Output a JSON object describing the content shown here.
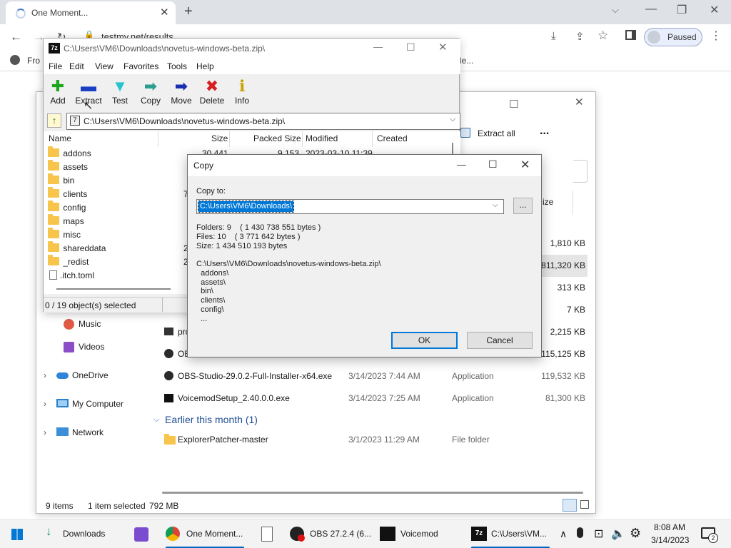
{
  "browser": {
    "tab_title": "One Moment...",
    "url": "testmy.net/results",
    "profile_label": "Paused",
    "bookmark_partial": "Fro",
    "bookmark_partial2": "le..."
  },
  "explorer": {
    "toolbar": {
      "extract_all": "Extract all",
      "more": "..."
    },
    "size_col_partial": "ize",
    "nav": [
      {
        "label": "Music"
      },
      {
        "label": "Videos"
      },
      {
        "label": "OneDrive"
      },
      {
        "label": "My Computer"
      },
      {
        "label": "Network"
      }
    ],
    "rows": [
      {
        "name": "",
        "date": "",
        "type": "",
        "size": "1,810 KB"
      },
      {
        "name": "",
        "date": "",
        "type": "",
        "size": "811,320 KB"
      },
      {
        "name": "",
        "date": "",
        "type": "",
        "size": "313 KB"
      },
      {
        "name": "",
        "date": "",
        "type": "",
        "size": "7 KB"
      },
      {
        "name": "pro",
        "date": "",
        "type": "",
        "size": "2,215 KB"
      },
      {
        "name": "OBS",
        "date": "",
        "type": "",
        "size": "115,125 KB"
      },
      {
        "name": "OBS-Studio-29.0.2-Full-Installer-x64.exe",
        "date": "3/14/2023 7:44 AM",
        "type": "Application",
        "size": "119,532 KB"
      },
      {
        "name": "VoicemodSetup_2.40.0.0.exe",
        "date": "3/14/2023 7:25 AM",
        "type": "Application",
        "size": "81,300 KB"
      }
    ],
    "group_header": "Earlier this month (1)",
    "group_row": {
      "name": "ExplorerPatcher-master",
      "date": "3/1/2023 11:29 AM",
      "type": "File folder"
    },
    "status": {
      "items": "9 items",
      "selected": "1 item selected",
      "size": "792 MB"
    }
  },
  "sevenzip": {
    "title": "C:\\Users\\VM6\\Downloads\\novetus-windows-beta.zip\\",
    "menu": [
      "File",
      "Edit",
      "View",
      "Favorites",
      "Tools",
      "Help"
    ],
    "toolbar": [
      {
        "label": "Add",
        "glyph": "✚",
        "color": "#1aa61a"
      },
      {
        "label": "Extract",
        "glyph": "▬",
        "color": "#1b3fc4"
      },
      {
        "label": "Test",
        "glyph": "▼",
        "color": "#27c4d0"
      },
      {
        "label": "Copy",
        "glyph": "➡",
        "color": "#2a9d8f"
      },
      {
        "label": "Move",
        "glyph": "➡",
        "color": "#1a2fb0"
      },
      {
        "label": "Delete",
        "glyph": "✖",
        "color": "#d62020"
      },
      {
        "label": "Info",
        "glyph": "ℹ",
        "color": "#c8a000"
      }
    ],
    "address": "C:\\Users\\VM6\\Downloads\\novetus-windows-beta.zip\\",
    "columns": [
      "Name",
      "Size",
      "Packed Size",
      "Modified",
      "Created"
    ],
    "first_row": {
      "size": "30 441",
      "packed": "9 153",
      "modified": "2023-03-10 11:39"
    },
    "partial_digits": [
      "7",
      "2",
      "2"
    ],
    "files": [
      {
        "name": "addons",
        "kind": "folder"
      },
      {
        "name": "assets",
        "kind": "folder"
      },
      {
        "name": "bin",
        "kind": "folder"
      },
      {
        "name": "clients",
        "kind": "folder"
      },
      {
        "name": "config",
        "kind": "folder"
      },
      {
        "name": "maps",
        "kind": "folder"
      },
      {
        "name": "misc",
        "kind": "folder"
      },
      {
        "name": "shareddata",
        "kind": "folder"
      },
      {
        "name": "_redist",
        "kind": "folder"
      },
      {
        "name": ".itch.toml",
        "kind": "file"
      }
    ],
    "status": "0 / 19 object(s) selected"
  },
  "copy_dialog": {
    "title": "Copy",
    "copy_to_label": "Copy to:",
    "path": "C:\\Users\\VM6\\Downloads\\",
    "browse": "...",
    "info": "Folders: 9    ( 1 430 738 551 bytes )\nFiles: 10    ( 3 771 642 bytes )\nSize: 1 434 510 193 bytes",
    "source": "C:\\Users\\VM6\\Downloads\\novetus-windows-beta.zip\\\n  addons\\\n  assets\\\n  bin\\\n  clients\\\n  config\\\n  ...",
    "ok": "OK",
    "cancel": "Cancel"
  },
  "taskbar": {
    "items": [
      {
        "label": "Downloads"
      },
      {
        "label": ""
      },
      {
        "label": "One Moment..."
      },
      {
        "label": ""
      },
      {
        "label": "OBS 27.2.4 (6..."
      },
      {
        "label": "Voicemod"
      },
      {
        "label": "C:\\Users\\VM..."
      }
    ],
    "time": "8:08 AM",
    "date": "3/14/2023",
    "notif_count": "2"
  }
}
